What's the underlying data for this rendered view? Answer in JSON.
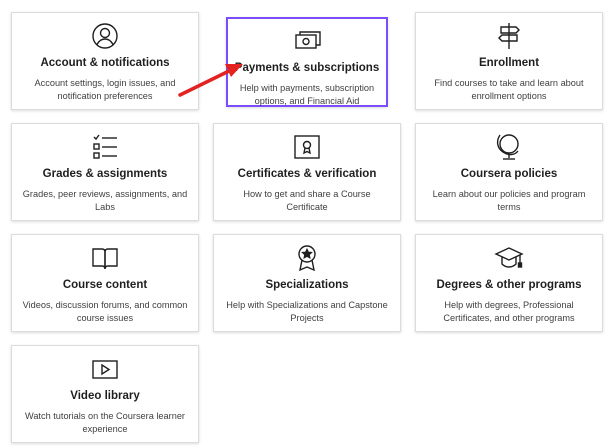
{
  "cards": [
    {
      "id": "account",
      "title": "Account & notifications",
      "desc": "Account settings, login issues, and notification preferences",
      "icon": "account-circle-icon"
    },
    {
      "id": "payments",
      "title": "Payments & subscriptions",
      "desc": "Help with payments, subscription options, and Financial Aid",
      "icon": "money-icon"
    },
    {
      "id": "enrollment",
      "title": "Enrollment",
      "desc": "Find courses to take and learn about enrollment options",
      "icon": "signpost-icon"
    },
    {
      "id": "grades",
      "title": "Grades & assignments",
      "desc": "Grades, peer reviews, assignments, and Labs",
      "icon": "checklist-icon"
    },
    {
      "id": "certificates",
      "title": "Certificates & verification",
      "desc": "How to get and share a Course Certificate",
      "icon": "certificate-icon"
    },
    {
      "id": "policies",
      "title": "Coursera policies",
      "desc": "Learn about our policies and program terms",
      "icon": "globe-icon"
    },
    {
      "id": "course-content",
      "title": "Course content",
      "desc": "Videos, discussion forums, and common course issues",
      "icon": "book-icon"
    },
    {
      "id": "specializations",
      "title": "Specializations",
      "desc": "Help with Specializations and Capstone Projects",
      "icon": "award-star-icon"
    },
    {
      "id": "degrees",
      "title": "Degrees & other programs",
      "desc": "Help with degrees, Professional Certificates, and other programs",
      "icon": "graduation-cap-icon"
    },
    {
      "id": "video-library",
      "title": "Video library",
      "desc": "Watch tutorials on the Coursera learner experience",
      "icon": "video-play-icon"
    }
  ],
  "highlight_color": "#7c4dff",
  "arrow_color": "#e32222",
  "highlighted_card": "payments"
}
